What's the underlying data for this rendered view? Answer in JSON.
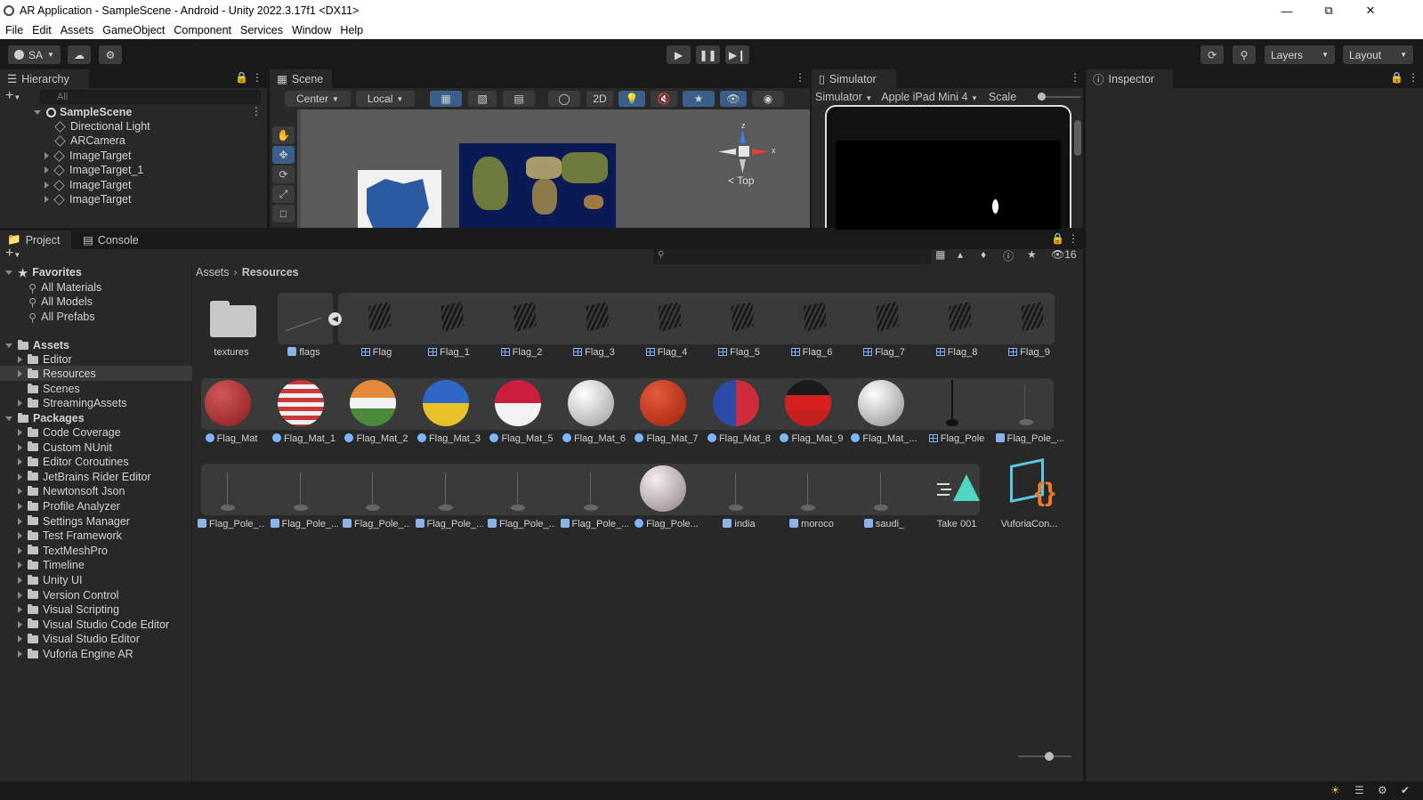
{
  "window": {
    "title": "AR Application - SampleScene - Android - Unity 2022.3.17f1 <DX11>",
    "minimize_icon": "minimize-icon",
    "maximize_icon": "restore-icon",
    "close_icon": "close-icon"
  },
  "menu": [
    "File",
    "Edit",
    "Assets",
    "GameObject",
    "Component",
    "Services",
    "Window",
    "Help"
  ],
  "toolbar": {
    "account": "SA",
    "layers": "Layers",
    "layout": "Layout"
  },
  "hierarchy": {
    "tab": "Hierarchy",
    "search_placeholder": "All",
    "scene": "SampleScene",
    "items": [
      "Directional Light",
      "ARCamera",
      "ImageTarget",
      "ImageTarget_1",
      "ImageTarget",
      "ImageTarget"
    ]
  },
  "scene": {
    "tab": "Scene",
    "pivot": "Center",
    "space": "Local",
    "mode2d": "2D",
    "view_label": "< Top",
    "gizmo_z": "z",
    "gizmo_x": "x"
  },
  "simulator": {
    "tab": "Simulator",
    "mode": "Simulator",
    "device": "Apple iPad Mini 4",
    "scale_label": "Scale"
  },
  "inspector": {
    "tab": "Inspector"
  },
  "project": {
    "tab_project": "Project",
    "tab_console": "Console",
    "hidden_count": "16",
    "breadcrumb": [
      "Assets",
      "Resources"
    ],
    "favorites": {
      "label": "Favorites",
      "items": [
        "All Materials",
        "All Models",
        "All Prefabs"
      ]
    },
    "assets": {
      "label": "Assets",
      "items": [
        "Editor",
        "Resources",
        "Scenes",
        "StreamingAssets"
      ]
    },
    "packages": {
      "label": "Packages",
      "items": [
        "Code Coverage",
        "Custom NUnit",
        "Editor Coroutines",
        "JetBrains Rider Editor",
        "Newtonsoft Json",
        "Profile Analyzer",
        "Settings Manager",
        "Test Framework",
        "TextMeshPro",
        "Timeline",
        "Unity UI",
        "Version Control",
        "Visual Scripting",
        "Visual Studio Code Editor",
        "Visual Studio Editor",
        "Vuforia Engine AR"
      ]
    },
    "row1": [
      "textures",
      "flags",
      "Flag",
      "Flag_1",
      "Flag_2",
      "Flag_3",
      "Flag_4",
      "Flag_5",
      "Flag_6",
      "Flag_7",
      "Flag_8",
      "Flag_9"
    ],
    "row2": [
      "Flag_Mat",
      "Flag_Mat_1",
      "Flag_Mat_2",
      "Flag_Mat_3",
      "Flag_Mat_5",
      "Flag_Mat_6",
      "Flag_Mat_7",
      "Flag_Mat_8",
      "Flag_Mat_9",
      "Flag_Mat_...",
      "Flag_Pole",
      "Flag_Pole_..."
    ],
    "row3": [
      "Flag_Pole_...",
      "Flag_Pole_...",
      "Flag_Pole_...",
      "Flag_Pole_...",
      "Flag_Pole_...",
      "Flag_Pole_...",
      "Flag_Pole...",
      "india",
      "moroco",
      "saudi_",
      "Take 001",
      "VuforiaCon..."
    ]
  },
  "colors": {
    "accent": "#3a79bb",
    "panel": "#282828",
    "bg": "#191919"
  }
}
